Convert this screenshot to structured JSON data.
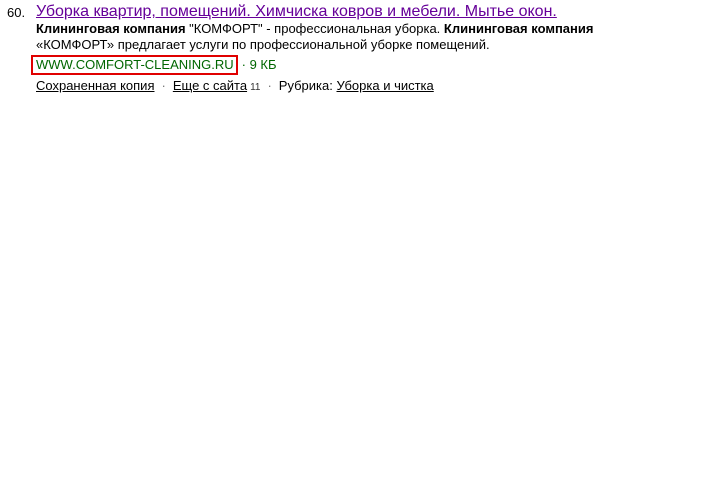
{
  "result": {
    "number": "60.",
    "title": "Уборка квартир, помещений. Химчиска ковров и мебели. Мытье окон.",
    "snippet": {
      "part1_bold": "Клининговая компания",
      "part2": " \"КОМФОРТ\" - профессиональная уборка. ",
      "part3_bold": "Клининговая компания",
      "part4": " «КОМФОРТ» предлагает услуги по профессиональной уборке помещений."
    },
    "url": "WWW.COMFORT-CLEANING.RU",
    "size": "· 9 КБ",
    "links": {
      "saved_copy": "Сохраненная копия",
      "separator": "·",
      "more_from_site": "Еще с сайта",
      "more_count": "11",
      "category_label": "Рубрика:",
      "category_link": "Уборка и чистка"
    }
  },
  "colors": {
    "title_visited": "#660099",
    "url_green": "#006600",
    "highlight_border": "#e00000"
  }
}
